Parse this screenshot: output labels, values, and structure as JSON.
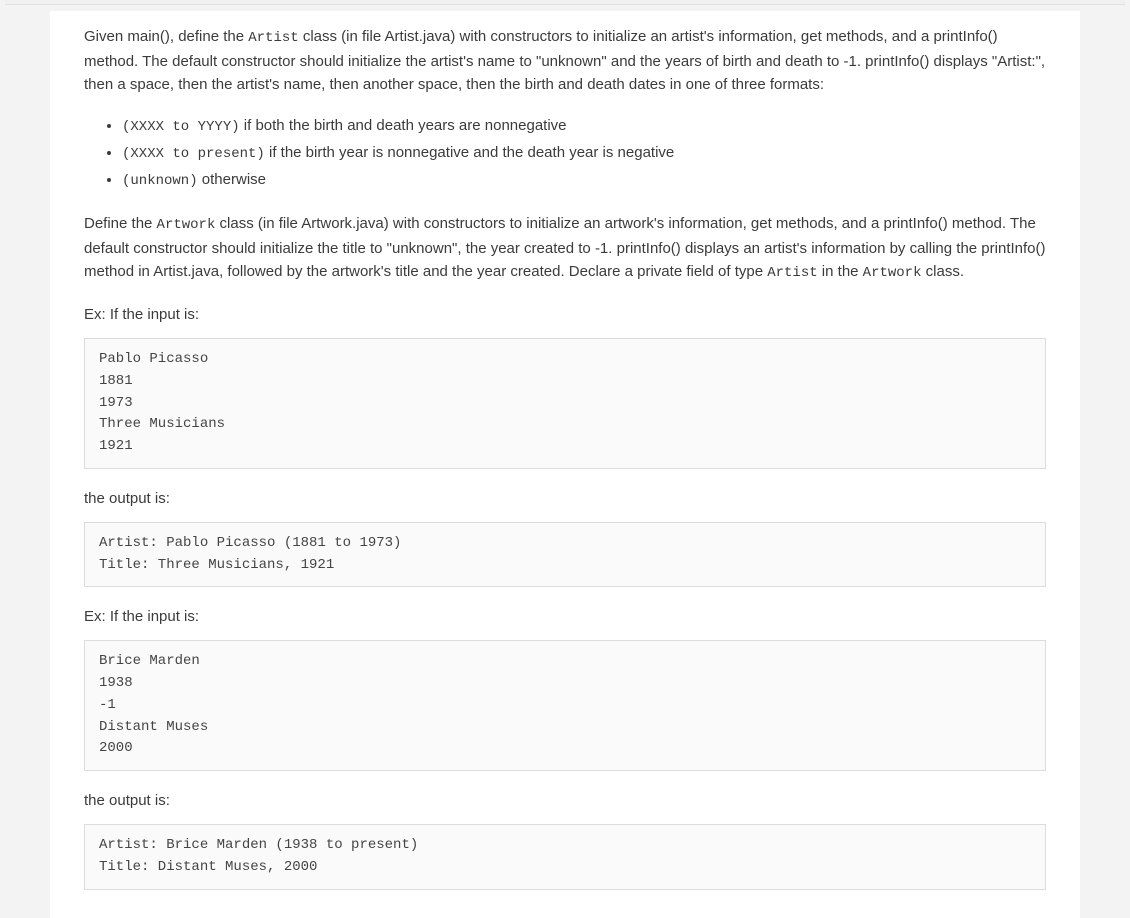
{
  "intro_seg1": "Given main(), define the ",
  "intro_code1": "Artist",
  "intro_seg2": " class (in file Artist.java) with constructors to initialize an artist's information, get methods, and a printInfo() method. The default constructor should initialize the artist's name to \"unknown\" and the years of birth and death to -1. printInfo() displays \"Artist:\", then a space, then the artist's name, then another space, then the birth and death dates in one of three formats:",
  "bullet1_code": "(XXXX to YYYY)",
  "bullet1_text": " if both the birth and death years are nonnegative",
  "bullet2_code": "(XXXX to present)",
  "bullet2_text": " if the birth year is nonnegative and the death year is negative",
  "bullet3_code": "(unknown)",
  "bullet3_text": " otherwise",
  "para2_seg1": "Define the ",
  "para2_code1": "Artwork",
  "para2_seg2": " class (in file Artwork.java) with constructors to initialize an artwork's information, get methods, and a printInfo() method. The default constructor should initialize the title to \"unknown\", the year created to -1. printInfo() displays an artist's information by calling the printInfo() method in Artist.java, followed by the artwork's title and the year created. Declare a private field of type ",
  "para2_code2": "Artist",
  "para2_seg3": " in the ",
  "para2_code3": "Artwork",
  "para2_seg4": " class.",
  "labels": {
    "ex_input": "Ex: If the input is:",
    "output_is": "the output is:"
  },
  "example1_input": "Pablo Picasso\n1881\n1973\nThree Musicians\n1921",
  "example1_output": "Artist: Pablo Picasso (1881 to 1973)\nTitle: Three Musicians, 1921",
  "example2_input": "Brice Marden\n1938\n-1\nDistant Muses\n2000",
  "example2_output": "Artist: Brice Marden (1938 to present)\nTitle: Distant Muses, 2000"
}
